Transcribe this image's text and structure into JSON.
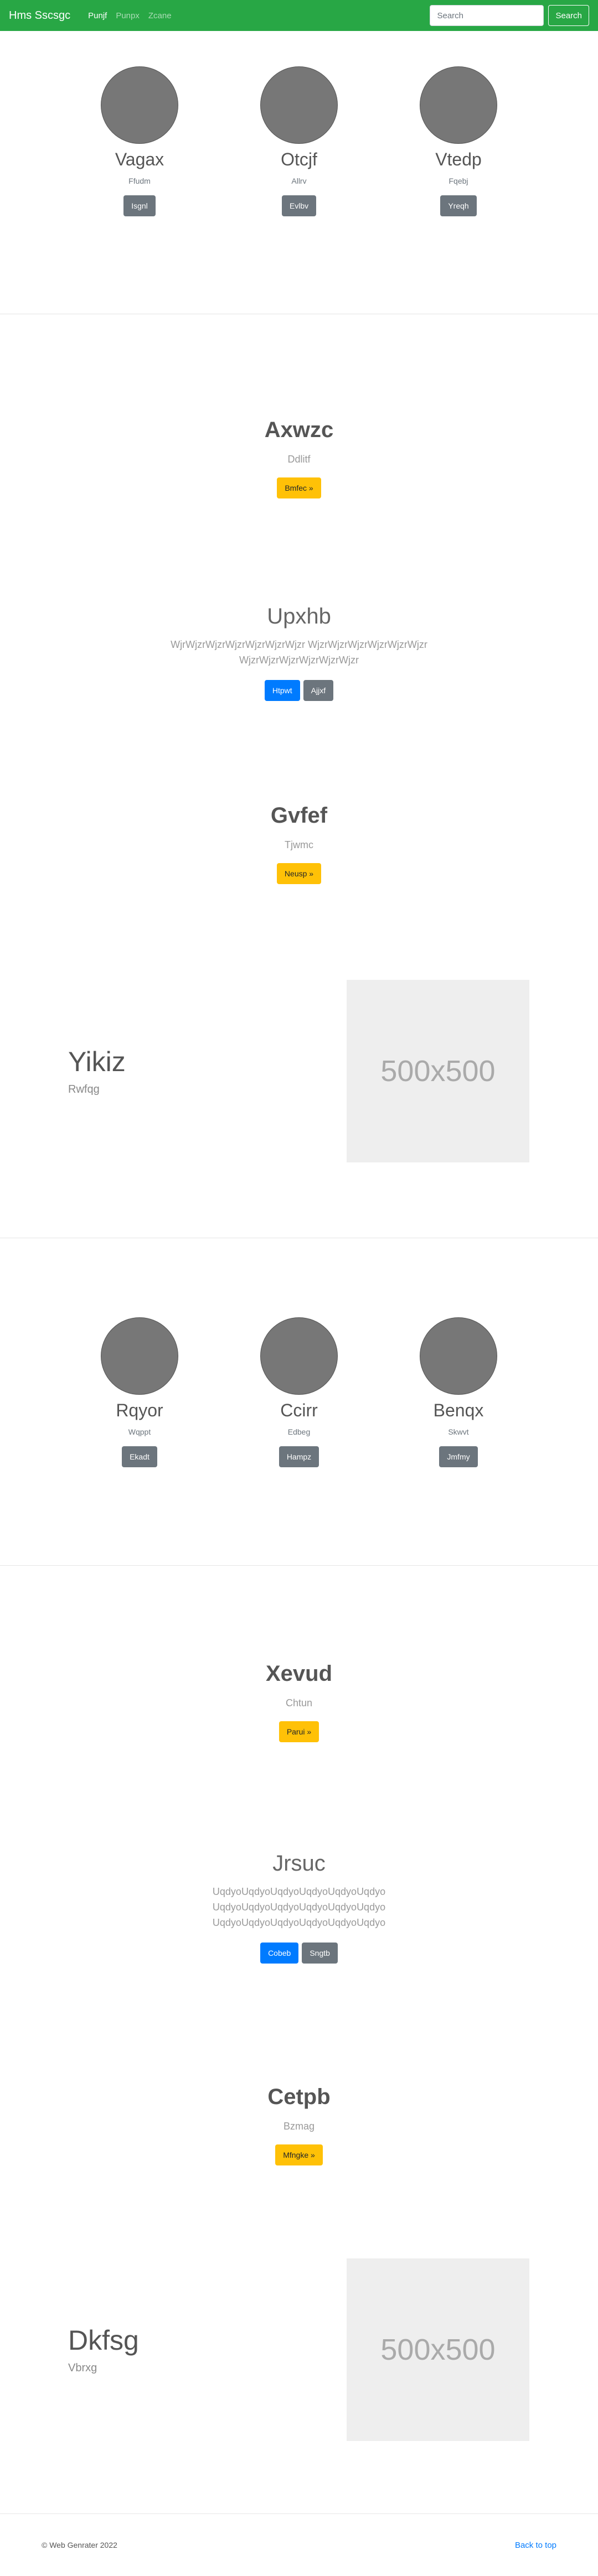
{
  "navbar": {
    "brand": "Hms Sscsgc",
    "links": [
      {
        "label": "Punjf"
      },
      {
        "label": "Punpx"
      },
      {
        "label": "Zcane"
      }
    ],
    "search_placeholder": "Search",
    "search_button": "Search"
  },
  "profiles_top": [
    {
      "name": "Vagax",
      "sub": "Ffudm",
      "button": "Isgnl"
    },
    {
      "name": "Otcjf",
      "sub": "Allrv",
      "button": "Evlbv"
    },
    {
      "name": "Vtedp",
      "sub": "Fqebj",
      "button": "Yreqh"
    }
  ],
  "hero1": {
    "title": "Axwzc",
    "sub": "Ddlitf",
    "button": "Bmfec »"
  },
  "text1": {
    "title": "Upxhb",
    "desc": "WjrWjzrWjzrWjzrWjzrWjzrWjzr WjzrWjzrWjzrWjzrWjzrWjzr WjzrWjzrWjzrWjzrWjzrWjzr",
    "buttons": [
      "Htpwt",
      "Ajjxf"
    ]
  },
  "hero2": {
    "title": "Gvfef",
    "sub": "Tjwmc",
    "button": "Neusp »"
  },
  "feature1": {
    "title": "Yikiz",
    "sub": "Rwfqg",
    "image_label": "500x500"
  },
  "profiles_bottom": [
    {
      "name": "Rqyor",
      "sub": "Wqppt",
      "button": "Ekadt"
    },
    {
      "name": "Ccirr",
      "sub": "Edbeg",
      "button": "Hampz"
    },
    {
      "name": "Benqx",
      "sub": "Skwvt",
      "button": "Jmfmy"
    }
  ],
  "hero3": {
    "title": "Xevud",
    "sub": "Chtun",
    "button": "Parui »"
  },
  "text2": {
    "title": "Jrsuc",
    "desc": "UqdyoUqdyoUqdyoUqdyoUqdyoUqdyo UqdyoUqdyoUqdyoUqdyoUqdyoUqdyo UqdyoUqdyoUqdyoUqdyoUqdyoUqdyo",
    "buttons": [
      "Cobeb",
      "Sngtb"
    ]
  },
  "hero4": {
    "title": "Cetpb",
    "sub": "Bzmag",
    "button": "Mfngke »"
  },
  "feature2": {
    "title": "Dkfsg",
    "sub": "Vbrxg",
    "image_label": "500x500"
  },
  "footer": {
    "copyright": "© Web Genrater 2022",
    "back_to_top": "Back to top"
  },
  "colors": {
    "navbar": "#28a745",
    "primary": "#007bff",
    "secondary": "#6c757d",
    "warning": "#ffc107"
  }
}
